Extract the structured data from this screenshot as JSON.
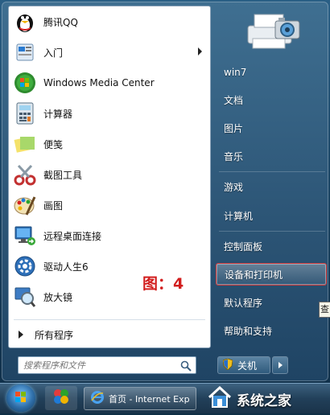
{
  "programs": [
    {
      "label": "腾讯QQ",
      "icon": "qq-penguin-icon"
    },
    {
      "label": "入门",
      "icon": "getting-started-icon",
      "has_submenu": true
    },
    {
      "label": "Windows Media Center",
      "icon": "media-center-icon"
    },
    {
      "label": "计算器",
      "icon": "calculator-icon"
    },
    {
      "label": "便笺",
      "icon": "sticky-notes-icon"
    },
    {
      "label": "截图工具",
      "icon": "snipping-tool-icon"
    },
    {
      "label": "画图",
      "icon": "paint-icon"
    },
    {
      "label": "远程桌面连接",
      "icon": "remote-desktop-icon"
    },
    {
      "label": "驱动人生6",
      "icon": "driver-life-icon"
    },
    {
      "label": "放大镜",
      "icon": "magnifier-icon"
    }
  ],
  "all_programs": "所有程序",
  "search": {
    "placeholder": "搜索程序和文件"
  },
  "right_items": [
    {
      "label": "win7"
    },
    {
      "label": "文档"
    },
    {
      "label": "图片"
    },
    {
      "label": "音乐"
    },
    {
      "label": "游戏"
    },
    {
      "label": "计算机"
    },
    {
      "label": "控制面板"
    },
    {
      "label": "设备和打印机",
      "highlighted": true
    },
    {
      "label": "默认程序"
    },
    {
      "label": "帮助和支持"
    }
  ],
  "shutdown_label": "关机",
  "annotation": "图：4",
  "tooltip_fragment": "查",
  "taskbar": {
    "ie_window_title": "首页 - Internet Exp"
  },
  "watermark": "系统之家",
  "colors": {
    "highlight_border": "#d23b3b",
    "annotation": "#d21e1e"
  }
}
